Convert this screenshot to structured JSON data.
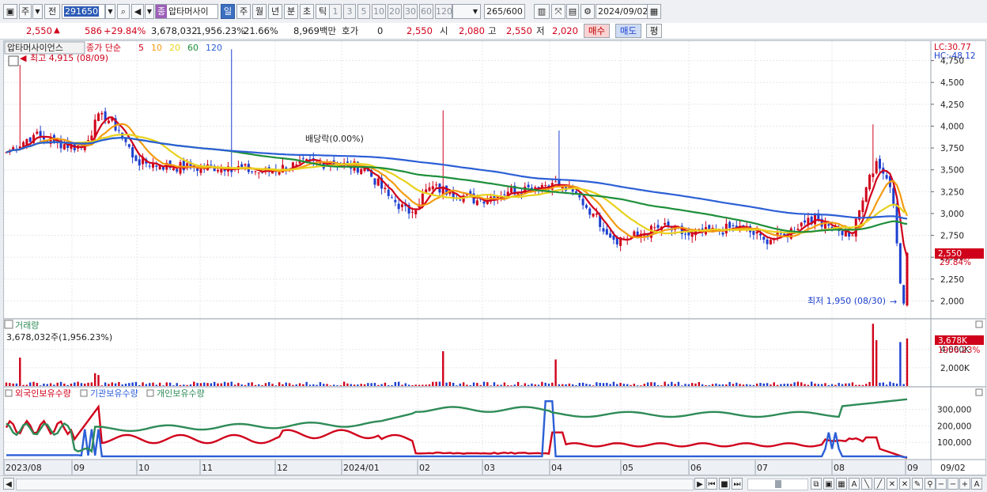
{
  "toolbar": {
    "market": "주",
    "prev_label": "전",
    "code": "291650",
    "stock_name": "압타머사이",
    "stock_tag": "종",
    "periods": [
      "일",
      "주",
      "월",
      "년",
      "분",
      "초",
      "틱"
    ],
    "active_period": "일",
    "intervals": [
      "1",
      "3",
      "5",
      "10",
      "20",
      "30",
      "60",
      "120"
    ],
    "count": "265",
    "count_max": "/600",
    "date": "2024/09/02"
  },
  "quote": {
    "price": "2,550",
    "change": "586",
    "change_pct": "+29.84%",
    "volume": "3,678,032",
    "volume_pct": "1,956.23%",
    "turnover": "21.66%",
    "amount": "8,969백만",
    "hoga_label": "호가",
    "hoga_value": "0",
    "hoga_price": "2,550",
    "open_label": "시",
    "open": "2,080",
    "high_label": "고",
    "high": "2,550",
    "low_label": "저",
    "low": "2,020",
    "buy_label": "매수",
    "sell_label": "매도",
    "flat_label": "평"
  },
  "price_panel": {
    "stock_label": "압타머사이언스",
    "ma_title": "종가 단순",
    "ma_periods": [
      "5",
      "10",
      "20",
      "60",
      "120"
    ],
    "ma_colors": [
      "#d0021b",
      "#f39c12",
      "#e8d21d",
      "#1e8f3a",
      "#2c5fd6"
    ],
    "high_note": "최고 4,915 (08/09)",
    "low_note": "최저 1,950 (08/30)",
    "dividend_note": "배당락(0.00%)",
    "lc": "LC:30.77",
    "hc": "HC:-48.12",
    "price_badge": "2,550",
    "pct_badge": "29.84%",
    "y_ticks": [
      "4,750",
      "4,500",
      "4,250",
      "4,000",
      "3,750",
      "3,500",
      "3,250",
      "3,000",
      "2,750",
      "2,500",
      "2,250",
      "2,000"
    ]
  },
  "volume_panel": {
    "title": "거래량",
    "value": "3,678,032주(1,956.23%)",
    "badge": "3,678K",
    "pct": "1956.23%",
    "y_ticks": [
      "4,000K",
      "2,000K"
    ]
  },
  "holding_panel": {
    "series": [
      "외국인보유수량",
      "기관보유수량",
      "개인보유수량"
    ],
    "colors": [
      "#d0021b",
      "#2c5fd6",
      "#2e8b57"
    ],
    "y_ticks": [
      "300,000",
      "200,000",
      "100,000"
    ]
  },
  "x_axis": {
    "labels": [
      "2023/08",
      "09",
      "10",
      "11",
      "12",
      "2024/01",
      "02",
      "03",
      "04",
      "05",
      "06",
      "07",
      "08",
      "09"
    ],
    "end_label": "09/02"
  },
  "chart_data": {
    "type": "candlestick",
    "y_range": [
      1850,
      4900
    ],
    "anchors": [
      {
        "i": 0,
        "price": 3700
      },
      {
        "i": 8,
        "price": 3900
      },
      {
        "i": 14,
        "price": 3820
      },
      {
        "i": 22,
        "price": 3750
      },
      {
        "i": 28,
        "price": 4150
      },
      {
        "i": 33,
        "price": 3950
      },
      {
        "i": 38,
        "price": 3600
      },
      {
        "i": 45,
        "price": 3550
      },
      {
        "i": 55,
        "price": 3520
      },
      {
        "i": 65,
        "price": 3540
      },
      {
        "i": 75,
        "price": 3470
      },
      {
        "i": 85,
        "price": 3560
      },
      {
        "i": 95,
        "price": 3580
      },
      {
        "i": 105,
        "price": 3520
      },
      {
        "i": 112,
        "price": 3200
      },
      {
        "i": 118,
        "price": 3000
      },
      {
        "i": 124,
        "price": 3300
      },
      {
        "i": 130,
        "price": 3250
      },
      {
        "i": 138,
        "price": 3150
      },
      {
        "i": 147,
        "price": 3250
      },
      {
        "i": 153,
        "price": 3300
      },
      {
        "i": 160,
        "price": 3350
      },
      {
        "i": 166,
        "price": 3250
      },
      {
        "i": 172,
        "price": 3000
      },
      {
        "i": 178,
        "price": 2700
      },
      {
        "i": 185,
        "price": 2750
      },
      {
        "i": 192,
        "price": 2850
      },
      {
        "i": 200,
        "price": 2750
      },
      {
        "i": 208,
        "price": 2800
      },
      {
        "i": 215,
        "price": 2850
      },
      {
        "i": 222,
        "price": 2700
      },
      {
        "i": 228,
        "price": 2750
      },
      {
        "i": 235,
        "price": 2950
      },
      {
        "i": 240,
        "price": 2900
      },
      {
        "i": 244,
        "price": 2800
      },
      {
        "i": 248,
        "price": 2750
      },
      {
        "i": 252,
        "price": 3300
      },
      {
        "i": 255,
        "price": 3600
      },
      {
        "i": 258,
        "price": 3400
      },
      {
        "i": 260,
        "price": 3100
      },
      {
        "i": 262,
        "price": 2200
      },
      {
        "i": 263,
        "price": 1970
      },
      {
        "i": 264,
        "price": 2550
      }
    ],
    "volume_spikes": [
      {
        "i": 4,
        "v": 3.1
      },
      {
        "i": 26,
        "v": 1.4
      },
      {
        "i": 27,
        "v": 1.2
      },
      {
        "i": 128,
        "v": 3.8
      },
      {
        "i": 161,
        "v": 2.9
      },
      {
        "i": 254,
        "v": 6.8
      },
      {
        "i": 255,
        "v": 5.0
      },
      {
        "i": 262,
        "v": 4.8
      },
      {
        "i": 264,
        "v": 5.2
      }
    ],
    "volume_max_k": 7000,
    "holding_range": [
      0,
      380000
    ]
  }
}
